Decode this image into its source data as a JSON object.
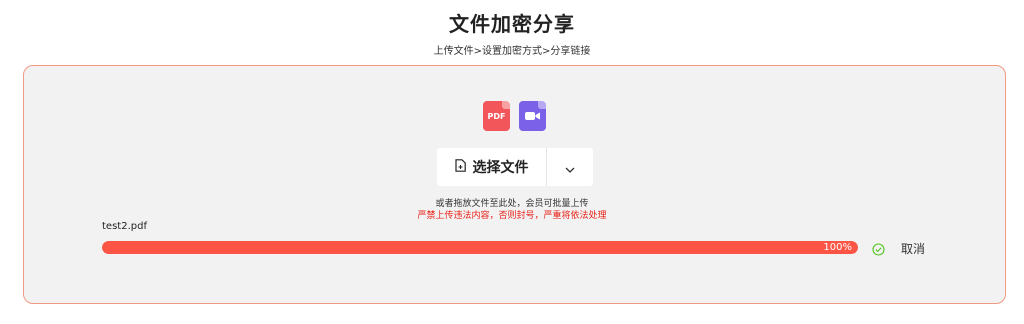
{
  "header": {
    "title": "文件加密分享",
    "breadcrumb": "上传文件>设置加密方式>分享链接"
  },
  "upload": {
    "file_types": [
      {
        "label": "PDF",
        "icon": "pdf-icon",
        "color": "#f2565a"
      },
      {
        "label": "",
        "icon": "video-icon",
        "color": "#7b61e8"
      }
    ],
    "select_button_label": "选择文件",
    "hint": "或者拖放文件至此处，会员可批量上传",
    "warning": "严禁上传违法内容，否则封号，严重将依法处理"
  },
  "file": {
    "name": "test2.pdf",
    "progress_percent": 100,
    "progress_label": "100%",
    "status_icon": "check-circle-icon",
    "cancel_label": "取消"
  },
  "colors": {
    "accent": "#fd5545",
    "border": "#f29a84",
    "warning": "#e8221a",
    "success": "#52c41a"
  }
}
